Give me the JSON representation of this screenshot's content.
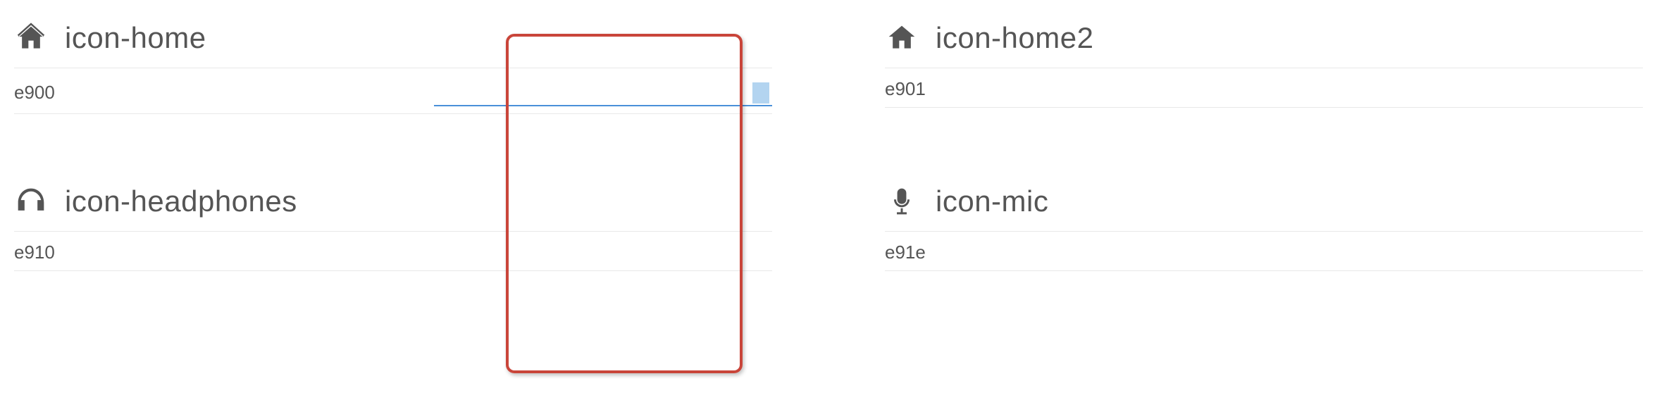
{
  "icons": [
    {
      "name": "icon-home",
      "code": "e900"
    },
    {
      "name": "icon-home2",
      "code": "e901"
    },
    {
      "name": "icon-headphones",
      "code": "e910"
    },
    {
      "name": "icon-mic",
      "code": "e91e"
    }
  ]
}
